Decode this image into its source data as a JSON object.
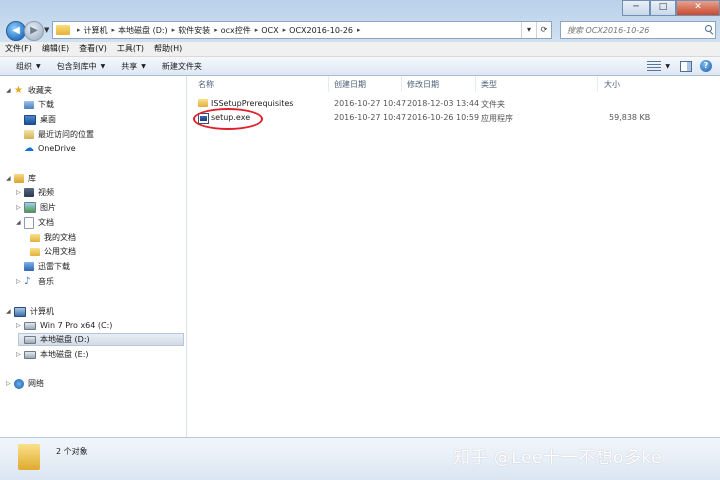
{
  "window": {
    "minimize_glyph": "─",
    "maximize_glyph": "□",
    "close_glyph": "✕"
  },
  "address": {
    "crumbs": [
      "计算机",
      "本地磁盘 (D:)",
      "软件安装",
      "ocx控件",
      "OCX",
      "OCX2016-10-26"
    ],
    "search_placeholder": "搜索 OCX2016-10-26"
  },
  "menu": [
    "文件(F)",
    "编辑(E)",
    "查看(V)",
    "工具(T)",
    "帮助(H)"
  ],
  "commands": {
    "organize": "组织",
    "include_in_library": "包含到库中",
    "share": "共享",
    "new_folder": "新建文件夹"
  },
  "nav": {
    "favorites": "收藏夹",
    "downloads": "下载",
    "desktop": "桌面",
    "recent": "最近访问的位置",
    "onedrive": "OneDrive",
    "libraries": "库",
    "videos": "视频",
    "pictures": "图片",
    "documents": "文档",
    "my_documents": "我的文档",
    "public_documents": "公用文档",
    "xunlei": "迅雷下载",
    "music": "音乐",
    "computer": "计算机",
    "drive_c": "Win 7 Pro x64 (C:)",
    "drive_d": "本地磁盘 (D:)",
    "drive_e": "本地磁盘 (E:)",
    "network": "网络"
  },
  "columns": {
    "name": "名称",
    "created": "创建日期",
    "modified": "修改日期",
    "type": "类型",
    "size": "大小"
  },
  "files": [
    {
      "name": "ISSetupPrerequisites",
      "created": "2016-10-27 10:47",
      "modified": "2018-12-03 13:44",
      "type": "文件夹",
      "size": "",
      "icon": "folder-icon"
    },
    {
      "name": "setup.exe",
      "created": "2016-10-27 10:47",
      "modified": "2016-10-26 10:59",
      "type": "应用程序",
      "size": "59,838 KB",
      "icon": "exe-icon"
    }
  ],
  "status": {
    "item_count": "2 个对象"
  },
  "watermark": "知乎 @Lee十一不想o多ke",
  "colors": {
    "accent": "#2a78c8",
    "highlight_ring": "#e0202a"
  }
}
